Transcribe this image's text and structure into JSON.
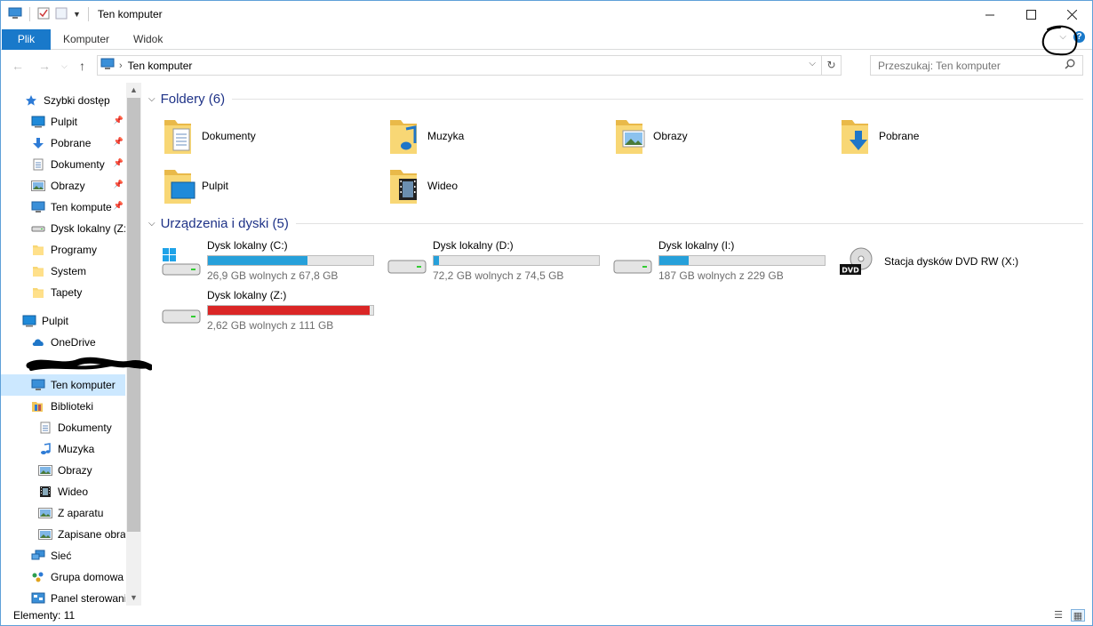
{
  "window": {
    "title": "Ten komputer"
  },
  "ribbon": {
    "tabs": [
      "Plik",
      "Komputer",
      "Widok"
    ]
  },
  "address": {
    "path_item": "Ten komputer"
  },
  "search": {
    "placeholder": "Przeszukaj: Ten komputer"
  },
  "sidebar": {
    "items": [
      {
        "label": "Szybki dostęp",
        "icon": "star-icon",
        "pinned": false
      },
      {
        "label": "Pulpit",
        "icon": "desktop-icon",
        "pinned": true
      },
      {
        "label": "Pobrane",
        "icon": "download-arrow-icon",
        "pinned": true
      },
      {
        "label": "Dokumenty",
        "icon": "document-icon",
        "pinned": true
      },
      {
        "label": "Obrazy",
        "icon": "picture-icon",
        "pinned": true
      },
      {
        "label": "Ten kompute",
        "icon": "computer-icon",
        "pinned": true
      },
      {
        "label": "Dysk lokalny (Z:)",
        "icon": "drive-icon",
        "pinned": false
      },
      {
        "label": "Programy",
        "icon": "folder-icon",
        "pinned": false
      },
      {
        "label": "System",
        "icon": "folder-icon",
        "pinned": false
      },
      {
        "label": "Tapety",
        "icon": "folder-icon",
        "pinned": false
      },
      {
        "label": "Pulpit",
        "icon": "desktop-icon",
        "pinned": false
      },
      {
        "label": "OneDrive",
        "icon": "cloud-icon",
        "pinned": false
      },
      {
        "label": "Ten komputer",
        "icon": "computer-icon",
        "pinned": false,
        "selected": true
      },
      {
        "label": "Biblioteki",
        "icon": "library-icon",
        "pinned": false
      },
      {
        "label": "Dokumenty",
        "icon": "document-icon",
        "pinned": false
      },
      {
        "label": "Muzyka",
        "icon": "music-note-icon",
        "pinned": false
      },
      {
        "label": "Obrazy",
        "icon": "picture-icon",
        "pinned": false
      },
      {
        "label": "Wideo",
        "icon": "film-icon",
        "pinned": false
      },
      {
        "label": "Z aparatu",
        "icon": "picture-icon",
        "pinned": false
      },
      {
        "label": "Zapisane obraz",
        "icon": "picture-icon",
        "pinned": false
      },
      {
        "label": "Sieć",
        "icon": "network-icon",
        "pinned": false
      },
      {
        "label": "Grupa domowa",
        "icon": "homegroup-icon",
        "pinned": false
      },
      {
        "label": "Panel sterowania",
        "icon": "control-panel-icon",
        "pinned": false
      }
    ]
  },
  "content": {
    "folders_header": "Foldery (6)",
    "folders": [
      {
        "name": "Dokumenty",
        "icon": "documents-folder-icon"
      },
      {
        "name": "Muzyka",
        "icon": "music-folder-icon"
      },
      {
        "name": "Obrazy",
        "icon": "pictures-folder-icon"
      },
      {
        "name": "Pobrane",
        "icon": "downloads-folder-icon"
      },
      {
        "name": "Pulpit",
        "icon": "desktop-folder-icon"
      },
      {
        "name": "Wideo",
        "icon": "videos-folder-icon"
      }
    ],
    "drives_header": "Urządzenia i dyski (5)",
    "drives": [
      {
        "name": "Dysk lokalny (C:)",
        "free": "26,9 GB wolnych z 67,8 GB",
        "used_fraction": 0.6,
        "bar_color": "#26a0da",
        "icon": "windows-drive-icon"
      },
      {
        "name": "Dysk lokalny (D:)",
        "free": "72,2 GB wolnych z 74,5 GB",
        "used_fraction": 0.03,
        "bar_color": "#26a0da",
        "icon": "drive-icon"
      },
      {
        "name": "Dysk lokalny (I:)",
        "free": "187 GB wolnych z 229 GB",
        "used_fraction": 0.18,
        "bar_color": "#26a0da",
        "icon": "drive-icon"
      },
      {
        "name": "Stacja dysków DVD RW (X:)",
        "free": "",
        "icon": "dvd-drive-icon"
      },
      {
        "name": "Dysk lokalny (Z:)",
        "free": "2,62 GB wolnych z 111 GB",
        "used_fraction": 0.98,
        "bar_color": "#da2626",
        "icon": "drive-icon"
      }
    ]
  },
  "status": {
    "items_count": "Elementy: 11"
  },
  "colors": {
    "accent": "#1979ca",
    "header_text": "#1e3287",
    "selection": "#cce8ff"
  }
}
